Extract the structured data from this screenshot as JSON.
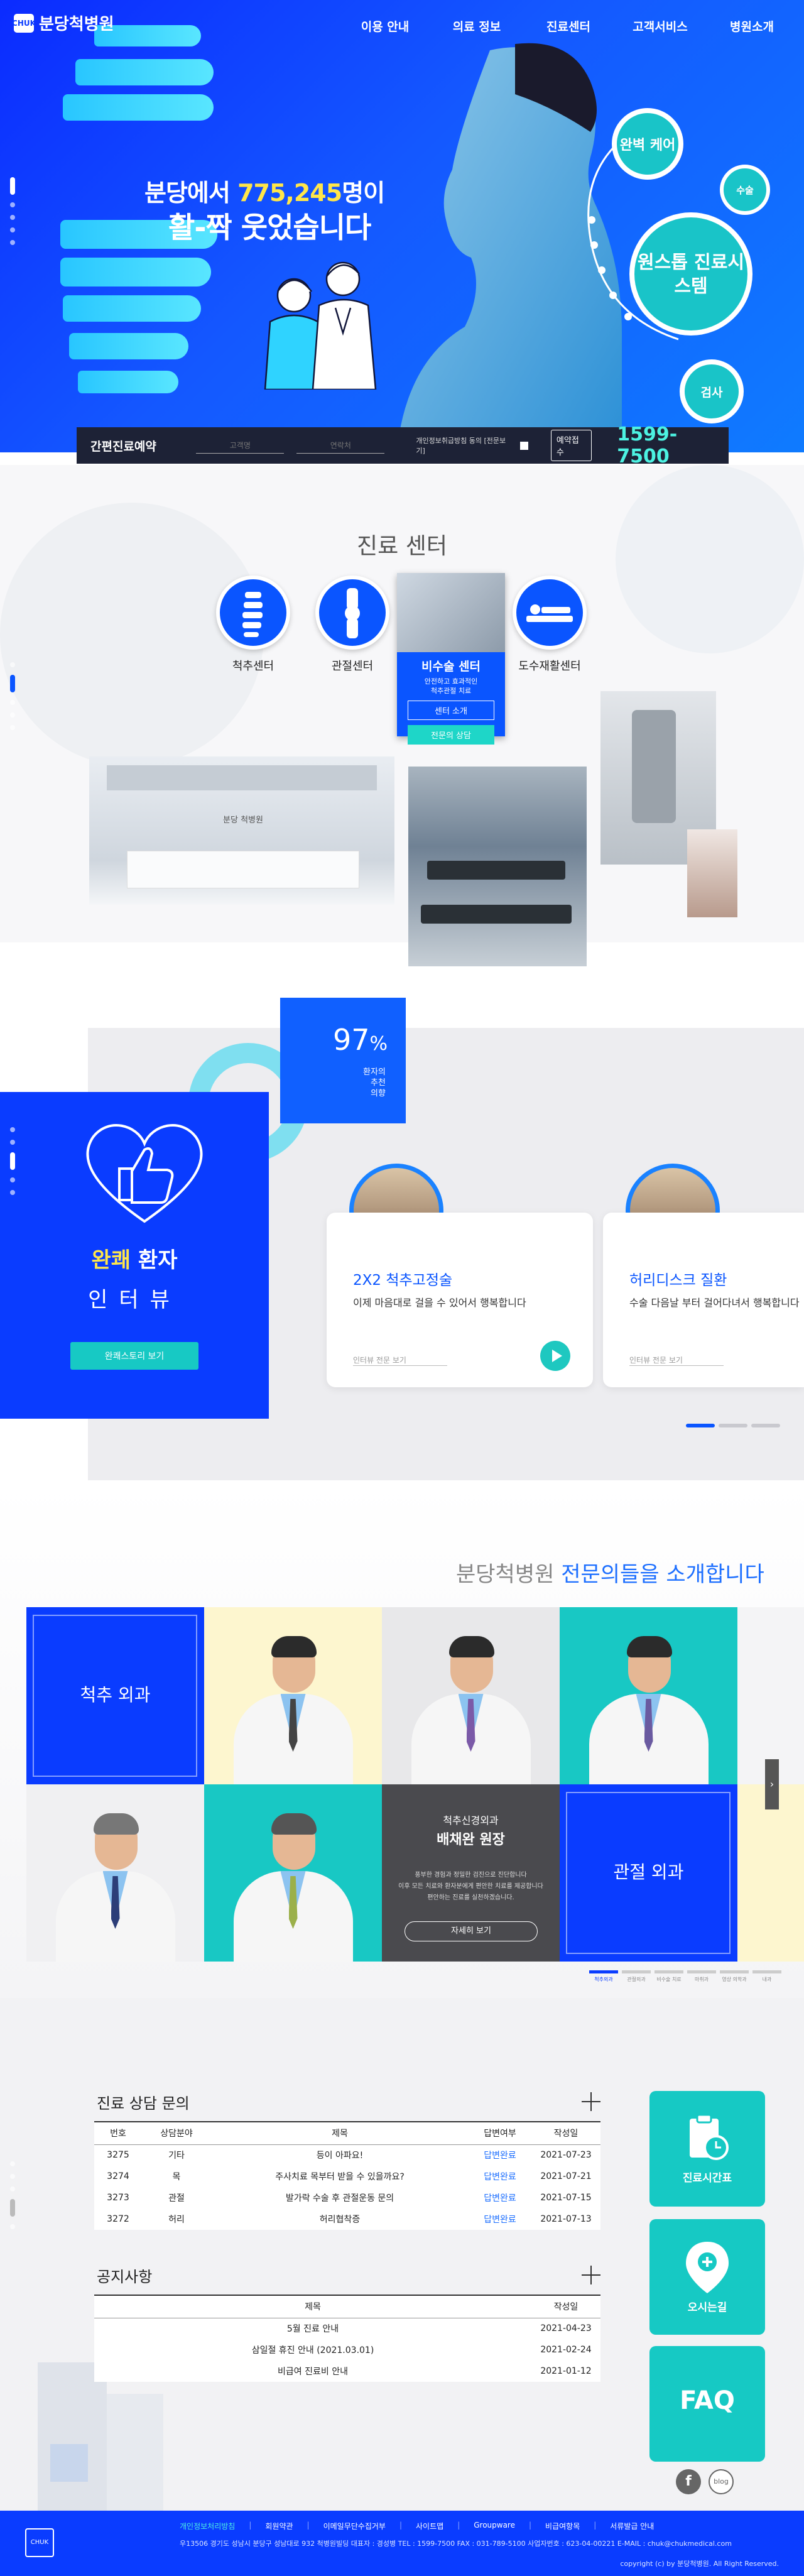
{
  "header": {
    "logo_text": "분당척병원",
    "nav": [
      "이용 안내",
      "의료 정보",
      "진료센터",
      "고객서비스",
      "병원소개"
    ]
  },
  "hero": {
    "title_prefix": "분당에서 ",
    "title_number": "775,245",
    "title_suffix": "명이",
    "title_line2": "활-짝 웃었습니다",
    "badges": [
      "완벽 케어",
      "원스톱 진료시스템",
      "수술",
      "검사"
    ]
  },
  "quick_reservation": {
    "title": "간편진료예약",
    "name_placeholder": "고객명",
    "phone_placeholder": "연락처",
    "agree_text": "개인정보취급방침 동의 [전문보기]",
    "submit_label": "예약접수",
    "phone": "1599-7500"
  },
  "center": {
    "title": "진료 센터",
    "items": [
      "척추센터",
      "관절센터",
      "비수술 센터",
      "도수재활센터"
    ],
    "card": {
      "title": "비수술 센터",
      "desc1": "안전하고 효과적인",
      "desc2": "척추관절 치료",
      "intro_button": "센터 소개",
      "consult_button": "전문의 상담"
    },
    "lobby_sign": "분당 척병원"
  },
  "interview": {
    "percent_value": "97",
    "percent_sign": "%",
    "percent_caption": [
      "환자의",
      "추천",
      "의향"
    ],
    "title_highlight": "완쾌",
    "title_rest": " 환자",
    "title_line2": "인터뷰",
    "more_button": "완쾌스토리 보기",
    "cards": [
      {
        "title": "2X2 척추고정술",
        "desc": "이제 마음대로 걸을 수 있어서 행복합니다",
        "more": "인터뷰 전문 보기"
      },
      {
        "title": "허리디스크 질환",
        "desc": "수술 다음날 부터 걸어다녀서 행복합니다",
        "more": "인터뷰 전문 보기"
      }
    ]
  },
  "doctors": {
    "title_prefix": "분당척병원 ",
    "title_highlight": "전문의들을 소개합니다",
    "cat_spine": "척추 외과",
    "cat_joint": "관절 외과",
    "featured_dept": "척추신경외과",
    "featured_name": "배채완 원장",
    "featured_desc": [
      "풍부한 경험과 정밀한 검진으로 진단합니다",
      "이후 모든 치료와 환자분에게 편안한 치료를 제공합니다",
      "편안하는 진료를 실천하겠습니다."
    ],
    "featured_button": "자세히 보기",
    "tabs": [
      "척추외과",
      "관절외과",
      "비수술 치료",
      "마취과",
      "영상 의학과",
      "내과"
    ]
  },
  "inquiry": {
    "title": "진료 상담 문의",
    "headers": [
      "번호",
      "상담분야",
      "제목",
      "답변여부",
      "작성일"
    ],
    "rows": [
      [
        "3275",
        "기타",
        "등이 아파요!",
        "답변완료",
        "2021-07-23"
      ],
      [
        "3274",
        "목",
        "주사치료 목부터 받을 수 있을까요?",
        "답변완료",
        "2021-07-21"
      ],
      [
        "3273",
        "관절",
        "발가락 수술 후 관절운동 문의",
        "답변완료",
        "2021-07-15"
      ],
      [
        "3272",
        "허리",
        "허리협착증",
        "답변완료",
        "2021-07-13"
      ]
    ]
  },
  "notice": {
    "title": "공지사항",
    "headers": [
      "제목",
      "작성일"
    ],
    "rows": [
      [
        "5월 진료 안내",
        "2021-04-23"
      ],
      [
        "삼일절 휴진 안내 (2021.03.01)",
        "2021-02-24"
      ],
      [
        "비급여 진료비 안내",
        "2021-01-12"
      ]
    ]
  },
  "quick_buttons": [
    "진료시간표",
    "오시는길",
    "FAQ"
  ],
  "social": [
    "f",
    "blog"
  ],
  "footer": {
    "menu": [
      "개인정보처리방침",
      "회원약관",
      "이메일무단수집거부",
      "사이트맵",
      "Groupware",
      "비급여항목",
      "서류발급 안내"
    ],
    "info": "우13506 경기도 성남시 분당구 성남대로 932 척병원빌딩    대표자 : 경성병 TEL : 1599-7500    FAX : 031-789-5100    사업자번호 : 623-04-00221    E-MAIL : chuk@chukmedical.com",
    "copyright": "copyright (c) by 분당척병원. All Right Reserved."
  },
  "colors": {
    "primary": "#0a3cff",
    "accent": "#16c9c4",
    "highlight": "#ffe64a"
  }
}
